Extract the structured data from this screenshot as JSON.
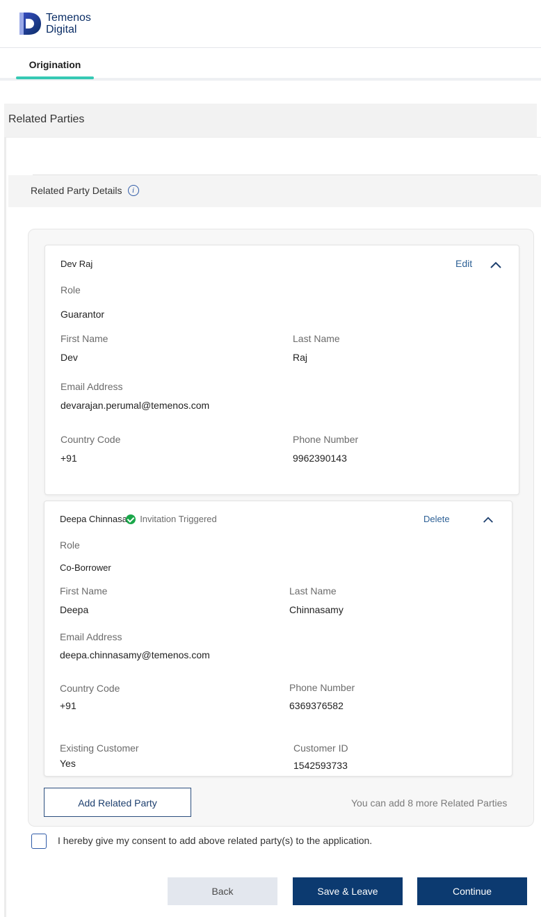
{
  "brand": {
    "line1": "Temenos",
    "line2": "Digital"
  },
  "tabs": [
    {
      "label": "Origination",
      "active": true
    }
  ],
  "section_title": "Related Parties",
  "details_title": "Related Party Details",
  "parties": [
    {
      "name": "Dev Raj",
      "action": "Edit",
      "status": "",
      "role_label": "Role",
      "role": "Guarantor",
      "first_name_label": "First Name",
      "first_name": "Dev",
      "last_name_label": "Last Name",
      "last_name": "Raj",
      "email_label": "Email Address",
      "email": "devarajan.perumal@temenos.com",
      "country_code_label": "Country Code",
      "country_code": "+91",
      "phone_label": "Phone Number",
      "phone": "9962390143"
    },
    {
      "name": "Deepa Chinnasar",
      "action": "Delete",
      "status": "Invitation Triggered",
      "role_label": "Role",
      "role": "Co-Borrower",
      "first_name_label": "First Name",
      "first_name": "Deepa",
      "last_name_label": "Last Name",
      "last_name": "Chinnasamy",
      "email_label": "Email Address",
      "email": "deepa.chinnasamy@temenos.com",
      "country_code_label": "Country Code",
      "country_code": "+91",
      "phone_label": "Phone Number",
      "phone": "6369376582",
      "existing_label": "Existing Customer",
      "existing": "Yes",
      "customer_id_label": "Customer ID",
      "customer_id": "1542593733"
    }
  ],
  "add_button": "Add Related Party",
  "add_note": "You can add 8 more Related Parties",
  "consent": {
    "text": "I hereby give my consent to add above related party(s) to the application.",
    "checked": false
  },
  "footer": {
    "back": "Back",
    "save": "Save & Leave",
    "continue": "Continue"
  },
  "colors": {
    "primary": "#0c3a70",
    "tab_accent": "#36c9b4",
    "success": "#1aa74a",
    "link": "#2e6196"
  }
}
